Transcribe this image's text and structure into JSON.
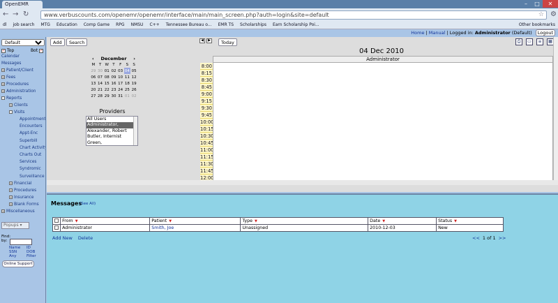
{
  "browser": {
    "tab_title": "OpenEMR",
    "url": "www.verbuscounts.com/openemr/openemr/interface/main/main_screen.php?auth=login&site=default",
    "bookmarks": [
      "dl",
      "job search",
      "MTG",
      "Education",
      "Comp Game",
      "RPG",
      "NMSU",
      "C++",
      "Tennessee Bureau o...",
      "EMR TS",
      "Scholarships",
      "Earn Scholarship Poi..."
    ],
    "other_bookmarks": "Other bookmarks"
  },
  "apptop": {
    "home": "Home",
    "manual": "Manual",
    "logged_in_prefix": "Logged in:",
    "user": "Administrator",
    "site": "(Default)",
    "logout": "Logout"
  },
  "leftnav": {
    "layout_select": "Default",
    "top_label": "Top",
    "bot_label": "Bot",
    "items": [
      {
        "label": "Calendar",
        "level": 0,
        "toggle": ""
      },
      {
        "label": "Messages",
        "level": 0,
        "toggle": ""
      },
      {
        "label": "Patient/Client",
        "level": 0,
        "toggle": "+"
      },
      {
        "label": "Fees",
        "level": 0,
        "toggle": "+"
      },
      {
        "label": "Procedures",
        "level": 0,
        "toggle": "+"
      },
      {
        "label": "Administration",
        "level": 0,
        "toggle": "+"
      },
      {
        "label": "Reports",
        "level": 0,
        "toggle": "-"
      },
      {
        "label": "Clients",
        "level": 1,
        "toggle": "+"
      },
      {
        "label": "Visits",
        "level": 1,
        "toggle": "-"
      },
      {
        "label": "Appointments",
        "level": 2,
        "toggle": ""
      },
      {
        "label": "Encounters",
        "level": 2,
        "toggle": ""
      },
      {
        "label": "Appt-Enc",
        "level": 2,
        "toggle": ""
      },
      {
        "label": "Superbill",
        "level": 2,
        "toggle": ""
      },
      {
        "label": "Chart Activity",
        "level": 2,
        "toggle": ""
      },
      {
        "label": "Charts Out",
        "level": 2,
        "toggle": ""
      },
      {
        "label": "Services",
        "level": 2,
        "toggle": ""
      },
      {
        "label": "Syndromic",
        "level": 2,
        "toggle": ""
      },
      {
        "label": "Surveillance",
        "level": 2,
        "toggle": ""
      },
      {
        "label": "Financial",
        "level": 1,
        "toggle": "+"
      },
      {
        "label": "Procedures",
        "level": 1,
        "toggle": "+"
      },
      {
        "label": "Insurance",
        "level": 1,
        "toggle": "+"
      },
      {
        "label": "Blank Forms",
        "level": 1,
        "toggle": "+"
      },
      {
        "label": "Miscellaneous",
        "level": 0,
        "toggle": "+"
      }
    ],
    "popups": "Popups",
    "find_label": "Find:",
    "by_label": "by:",
    "find_options": [
      "Name",
      "ID",
      "SSN",
      "DOB",
      "Any",
      "Filter"
    ],
    "online_support": "Online Support"
  },
  "calendar": {
    "add_button": "Add",
    "search_button": "Search",
    "today_button": "Today",
    "mini_month": "December",
    "weekday_headers": [
      "M",
      "T",
      "W",
      "T",
      "F",
      "S",
      "S"
    ],
    "mini_weeks": [
      [
        "29",
        "30",
        "01",
        "02",
        "03",
        "04",
        "05"
      ],
      [
        "06",
        "07",
        "08",
        "09",
        "10",
        "11",
        "12"
      ],
      [
        "13",
        "14",
        "15",
        "16",
        "17",
        "18",
        "19"
      ],
      [
        "20",
        "21",
        "22",
        "23",
        "24",
        "25",
        "26"
      ],
      [
        "27",
        "28",
        "29",
        "30",
        "31",
        "01",
        "02"
      ]
    ],
    "providers_title": "Providers",
    "providers": [
      "All Users",
      "Administrator,",
      "Alexander, Robert",
      "Butler, Internist",
      "Green,"
    ],
    "selected_provider": 1,
    "day_title": "04 Dec 2010",
    "column_header": "Administrator",
    "times": [
      "8:00",
      "8:15",
      "8:30",
      "8:45",
      "9:00",
      "9:15",
      "9:30",
      "9:45",
      "10:00",
      "10:15",
      "10:30",
      "10:45",
      "11:00",
      "11:15",
      "11:30",
      "11:45",
      "12:00"
    ]
  },
  "messages": {
    "title": "Messages",
    "see_all": "(See All)",
    "columns": [
      "From",
      "Patient",
      "Type",
      "Date",
      "Status"
    ],
    "rows": [
      {
        "from": "Administrator",
        "patient": "Smith, Joe",
        "type": "Unassigned",
        "date": "2010-12-03",
        "status": "New"
      }
    ],
    "add_new": "Add New",
    "delete": "Delete",
    "pager_prev": "<<",
    "pager_text": "1 of 1",
    "pager_next": ">>"
  }
}
